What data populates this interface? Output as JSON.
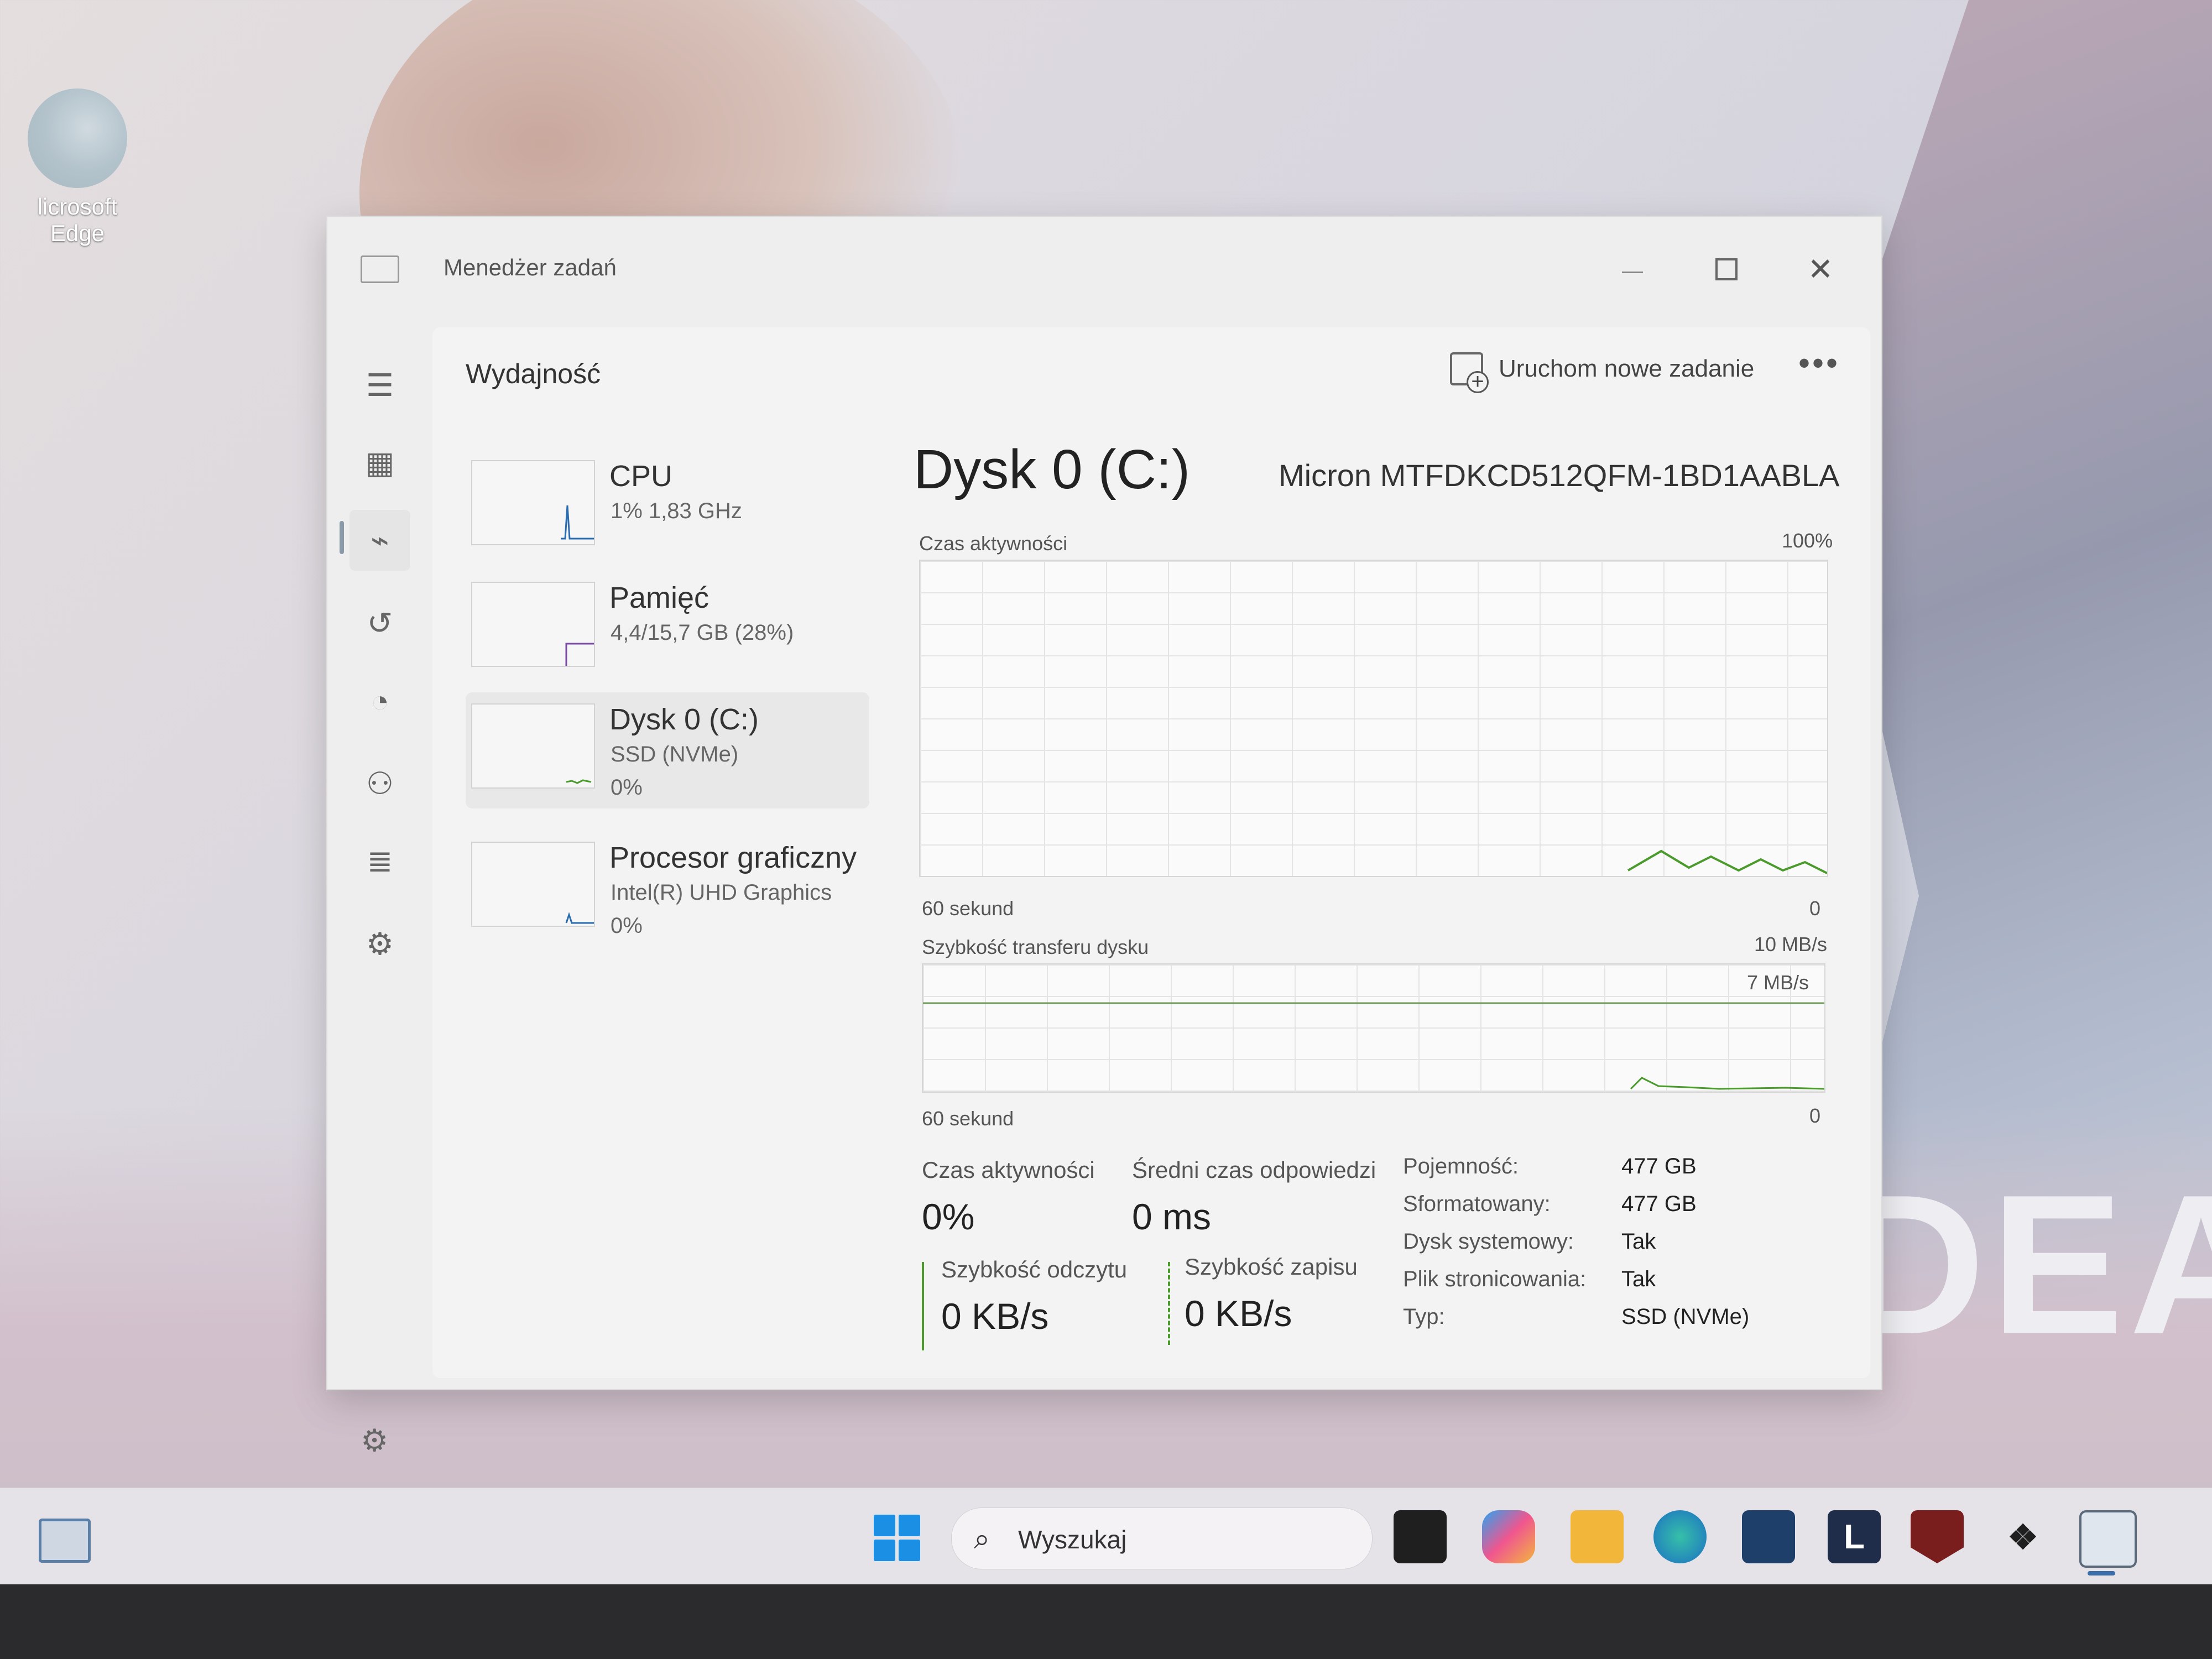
{
  "desktop": {
    "icon_label": "licrosoft Edge",
    "wallpaper_brand": "DEA"
  },
  "window": {
    "title": "Menedżer zadań",
    "header_title": "Wydajność",
    "run_task_label": "Uruchom nowe zadanie",
    "more_label": "•••"
  },
  "perf_list": [
    {
      "name": "CPU",
      "sub": "1%  1,83 GHz",
      "sub2": ""
    },
    {
      "name": "Pamięć",
      "sub": "4,4/15,7 GB (28%)",
      "sub2": ""
    },
    {
      "name": "Dysk 0 (C:)",
      "sub": "SSD (NVMe)",
      "sub2": "0%"
    },
    {
      "name": "Procesor graficzny",
      "sub": "Intel(R) UHD Graphics",
      "sub2": "0%"
    }
  ],
  "detail": {
    "title": "Dysk 0 (C:)",
    "model": "Micron MTFDKCD512QFM-1BD1AABLA",
    "activity_chart": {
      "label": "Czas aktywności",
      "max": "100%",
      "x_label": "60 sekund",
      "min": "0"
    },
    "transfer_chart": {
      "label": "Szybkość transferu dysku",
      "max": "10 MB/s",
      "marker": "7 MB/s",
      "x_label": "60 sekund",
      "min": "0"
    },
    "stats": {
      "active_time_label": "Czas aktywności",
      "active_time_value": "0%",
      "response_label": "Średni czas odpowiedzi",
      "response_value": "0 ms",
      "read_label": "Szybkość odczytu",
      "read_value": "0 KB/s",
      "write_label": "Szybkość zapisu",
      "write_value": "0 KB/s"
    },
    "properties": [
      {
        "label": "Pojemność:",
        "value": "477 GB"
      },
      {
        "label": "Sformatowany:",
        "value": "477 GB"
      },
      {
        "label": "Dysk systemowy:",
        "value": "Tak"
      },
      {
        "label": "Plik stronicowania:",
        "value": "Tak"
      },
      {
        "label": "Typ:",
        "value": "SSD (NVMe)"
      }
    ]
  },
  "taskbar": {
    "search_placeholder": "Wyszukaj",
    "app_l_label": "L"
  },
  "colors": {
    "disk_green": "#4a9a2c",
    "accent_blue": "#1a8fe3"
  },
  "icons": [
    "hamburger-icon",
    "processes-icon",
    "performance-icon",
    "app-history-icon",
    "startup-icon",
    "users-icon",
    "details-icon",
    "services-icon",
    "settings-icon"
  ]
}
